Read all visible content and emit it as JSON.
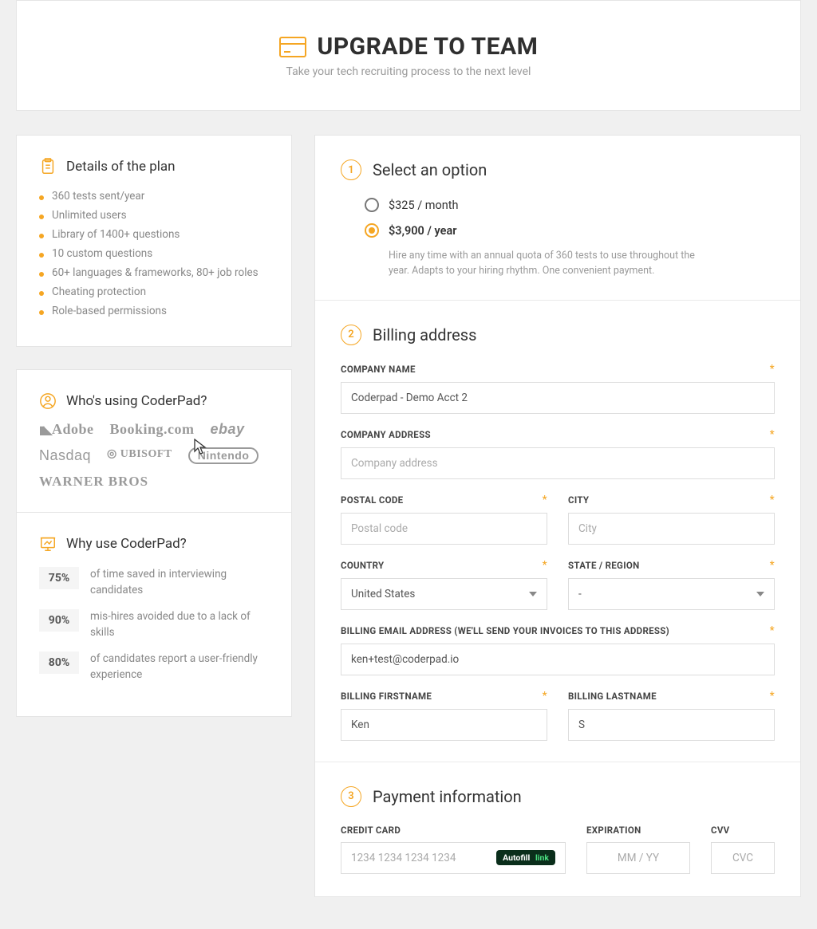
{
  "header": {
    "title": "UPGRADE TO TEAM",
    "subtitle": "Take your tech recruiting process to the next level"
  },
  "sidebar": {
    "plan": {
      "title": "Details of the plan",
      "items": [
        "360 tests sent/year",
        "Unlimited users",
        "Library of 1400+ questions",
        "10 custom questions",
        "60+ languages & frameworks, 80+ job roles",
        "Cheating protection",
        "Role-based permissions"
      ]
    },
    "who": {
      "title": "Who's using CoderPad?",
      "logos": [
        "Adobe",
        "Booking.com",
        "ebay",
        "Nasdaq",
        "UBISOFT",
        "Nintendo",
        "WARNER BROS"
      ]
    },
    "why": {
      "title": "Why use CoderPad?",
      "stats": [
        {
          "value": "75%",
          "text": "of time saved in interviewing candidates"
        },
        {
          "value": "90%",
          "text": "mis-hires avoided due to a lack of skills"
        },
        {
          "value": "80%",
          "text": "of candidates report a user-friendly experience"
        }
      ]
    }
  },
  "step1": {
    "num": "1",
    "title": "Select an option",
    "options": [
      {
        "label": "$325 / month",
        "selected": false
      },
      {
        "label": "$3,900 / year",
        "selected": true
      }
    ],
    "desc": "Hire any time with an annual quota of 360 tests to use throughout the year. Adapts to your hiring rhythm. One convenient payment."
  },
  "step2": {
    "num": "2",
    "title": "Billing address",
    "company_name": {
      "label": "COMPANY NAME",
      "value": "Coderpad - Demo Acct 2"
    },
    "company_addr": {
      "label": "COMPANY ADDRESS",
      "placeholder": "Company address",
      "value": ""
    },
    "postal": {
      "label": "POSTAL CODE",
      "placeholder": "Postal code",
      "value": ""
    },
    "city": {
      "label": "CITY",
      "placeholder": "City",
      "value": ""
    },
    "country": {
      "label": "COUNTRY",
      "value": "United States"
    },
    "state": {
      "label": "STATE / REGION",
      "value": "-"
    },
    "email": {
      "label": "BILLING EMAIL ADDRESS (WE'LL SEND YOUR INVOICES TO THIS ADDRESS)",
      "value": "ken+test@coderpad.io"
    },
    "first": {
      "label": "BILLING FIRSTNAME",
      "value": "Ken"
    },
    "last": {
      "label": "BILLING LASTNAME",
      "value": "S"
    }
  },
  "step3": {
    "num": "3",
    "title": "Payment information",
    "card": {
      "label": "CREDIT CARD",
      "placeholder": "1234 1234 1234 1234",
      "autofill_a": "Autofill",
      "autofill_b": "link"
    },
    "exp": {
      "label": "EXPIRATION",
      "placeholder": "MM / YY"
    },
    "cvv": {
      "label": "CVV",
      "placeholder": "CVC"
    }
  },
  "asterisk": "*"
}
